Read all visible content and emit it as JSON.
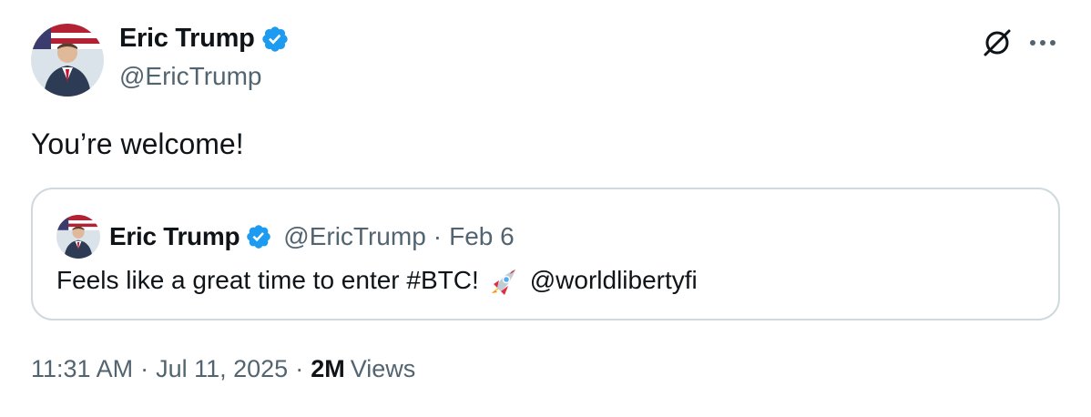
{
  "author": {
    "name": "Eric Trump",
    "handle": "@EricTrump",
    "avatar_icon": "avatar-photo",
    "verified_icon": "verified-badge-icon",
    "verified_color": "#1d9bf0"
  },
  "tweet": {
    "text": "You’re welcome!"
  },
  "quote": {
    "name": "Eric Trump",
    "handle": "@EricTrump",
    "separator": "·",
    "date": "Feb 6",
    "text": "Feels like a great time to enter #BTC!",
    "emoji_icon": "rocket-icon",
    "mention": "@worldlibertyfi"
  },
  "meta": {
    "time": "11:31 AM",
    "separator": "·",
    "date": "Jul 11, 2025",
    "views_count": "2M",
    "views_label": "Views"
  },
  "colors": {
    "text": "#0f1419",
    "secondary": "#536471",
    "border": "#cfd9de"
  }
}
